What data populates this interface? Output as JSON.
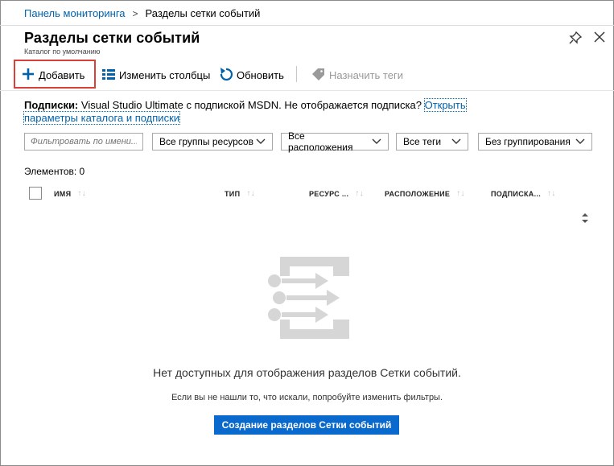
{
  "breadcrumb": {
    "parent": "Панель мониторинга",
    "separator": ">",
    "current": "Разделы сетки событий"
  },
  "blade": {
    "title": "Разделы сетки событий",
    "subtitle": "Каталог по умолчанию"
  },
  "toolbar": {
    "add_label": "Добавить",
    "edit_columns_label": "Изменить столбцы",
    "refresh_label": "Обновить",
    "assign_tags_label": "Назначить теги"
  },
  "subscriptions": {
    "label": "Подписки:",
    "text": " Visual Studio Ultimate с подпиской MSDN. Не отображается подписка? ",
    "link_part1": "Открыть",
    "link_part2": "параметры каталога и подписки"
  },
  "filters": {
    "name_placeholder": "Фильтровать по имени...",
    "resource_groups": "Все группы ресурсов",
    "locations": "Все расположения",
    "tags": "Все теги",
    "grouping": "Без группирования"
  },
  "items_count": "Элементов: 0",
  "columns": [
    "ИМЯ",
    "ТИП",
    "РЕСУРС ...",
    "РАСПОЛОЖЕНИЕ",
    "ПОДПИСКА..."
  ],
  "empty": {
    "message": "Нет доступных для отображения разделов Сетки событий.",
    "hint": "Если вы не нашли то, что искали, попробуйте изменить фильтры.",
    "create_label": "Создание разделов Сетки событий"
  },
  "colors": {
    "link": "#0062ad",
    "accent": "#0a69cc",
    "highlight": "#d9403a"
  },
  "icons": [
    "plus-icon",
    "columns-icon",
    "refresh-icon",
    "tag-icon",
    "pin-icon",
    "close-icon",
    "chevron-down-icon",
    "sort-icon",
    "event-grid-empty-icon"
  ]
}
